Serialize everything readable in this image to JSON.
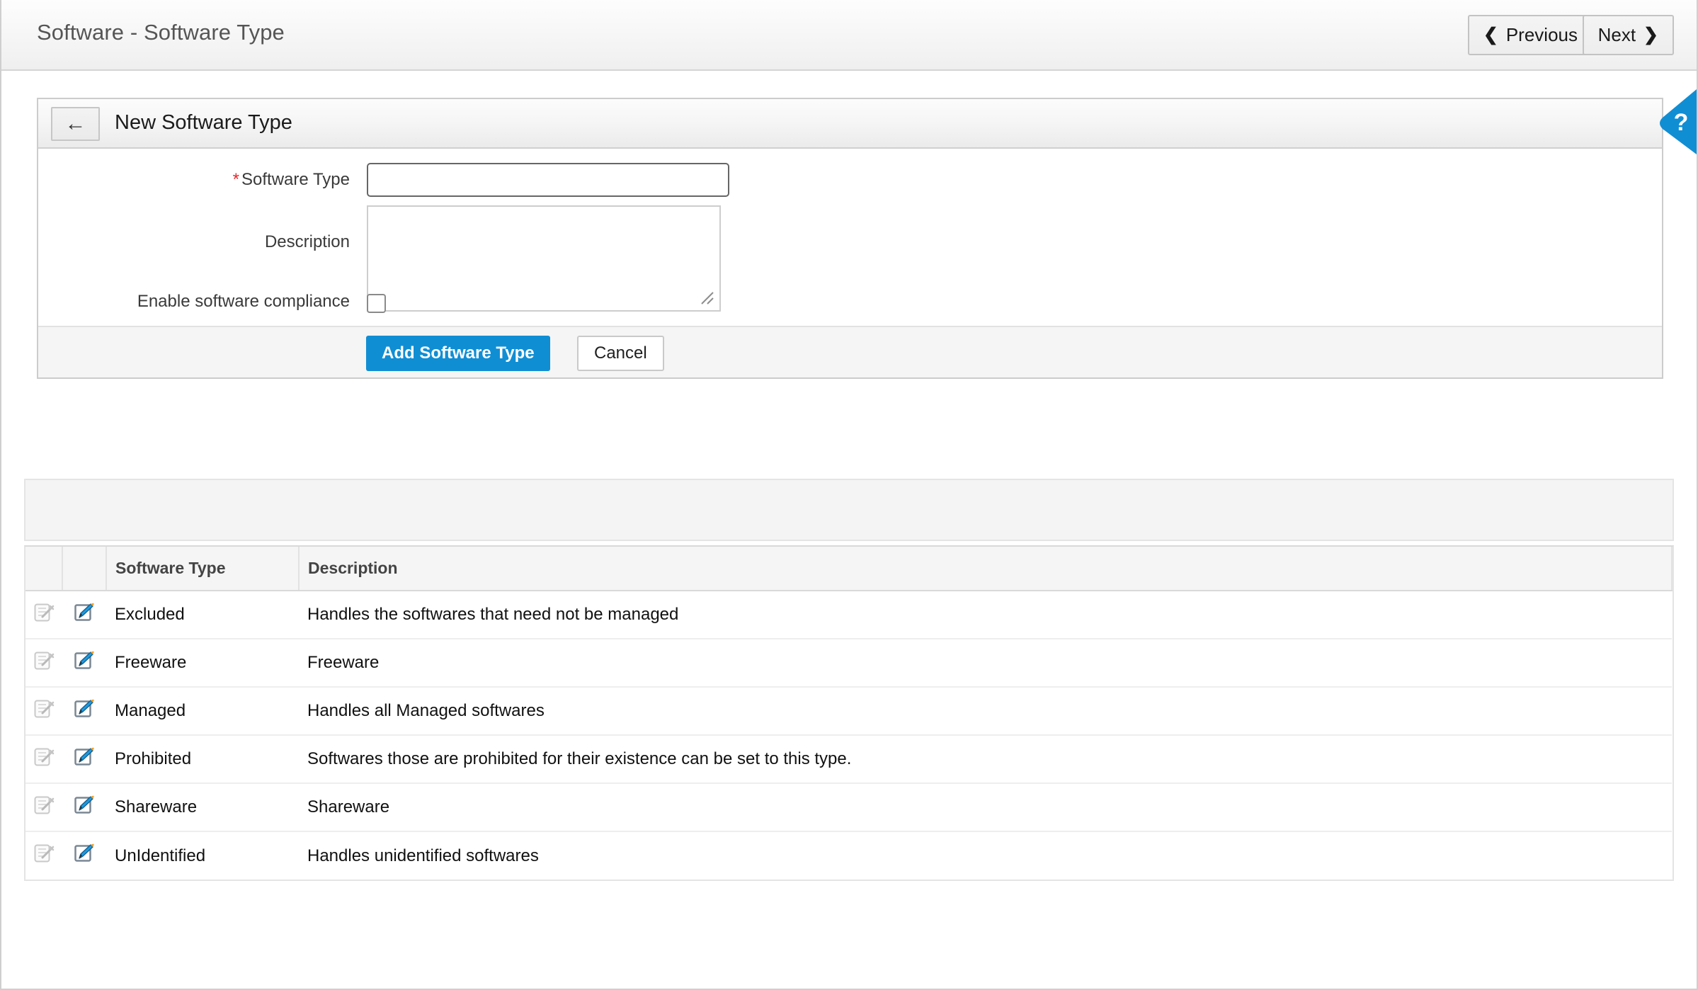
{
  "header": {
    "title": "Software - Software Type",
    "previous_label": "Previous",
    "next_label": "Next",
    "previous_icon": "chevron-left-icon",
    "next_icon": "chevron-right-icon"
  },
  "help_tab": {
    "label": "?",
    "icon": "help-question-icon",
    "color": "#108ed4"
  },
  "form": {
    "title": "New Software Type",
    "back_icon": "arrow-left-icon",
    "fields": {
      "software_type": {
        "label": "Software Type",
        "required_marker": "*",
        "value": "",
        "placeholder": ""
      },
      "description": {
        "label": "Description",
        "value": "",
        "placeholder": ""
      },
      "compliance": {
        "label": "Enable software compliance",
        "checked": false
      }
    },
    "submit_label": "Add Software Type",
    "cancel_label": "Cancel",
    "submit_color": "#108ed4"
  },
  "table": {
    "columns": [
      "",
      "",
      "Software Type",
      "Description"
    ],
    "row_icons": {
      "first": "config-disabled-icon",
      "second": "edit-pencil-icon"
    },
    "rows": [
      {
        "type": "Excluded",
        "description": "Handles the softwares that need not be managed"
      },
      {
        "type": "Freeware",
        "description": "Freeware"
      },
      {
        "type": "Managed",
        "description": "Handles all Managed softwares"
      },
      {
        "type": "Prohibited",
        "description": "Softwares those are prohibited for their existence can be set to this type."
      },
      {
        "type": "Shareware",
        "description": "Shareware"
      },
      {
        "type": "UnIdentified",
        "description": "Handles unidentified softwares"
      }
    ]
  }
}
